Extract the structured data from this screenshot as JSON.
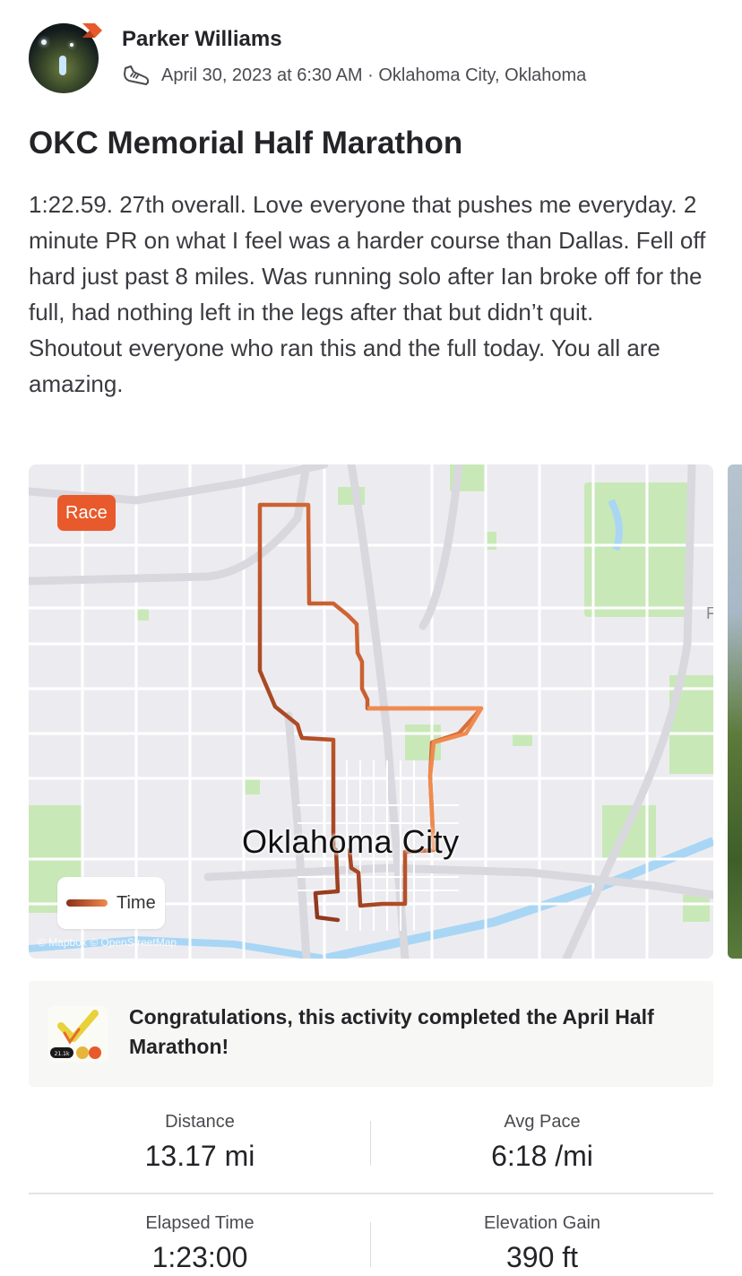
{
  "user": {
    "name": "Parker Williams",
    "avatar_icon": "profile-photo",
    "badge_icon": "subscriber-badge-icon"
  },
  "activity": {
    "type_icon": "shoe-icon",
    "meta": "April 30, 2023 at 6:30 AM · Oklahoma City, Oklahoma",
    "title": "OKC Memorial Half Marathon",
    "description": [
      "1:22.59. 27th overall. Love everyone that pushes me everyday. 2 minute PR on what I feel was a harder course than Dallas. Fell off hard just past 8 miles. Was running solo after Ian broke off for the full, had nothing left in the legs after that but didn’t quit.",
      "Shoutout everyone who ran this and the full today. You all are amazing."
    ]
  },
  "map": {
    "badge": "Race",
    "badge_color": "#e85a2b",
    "city_label": "Oklahoma City",
    "legend_label": "Time",
    "attribution": "© Mapbox © OpenStreetMap",
    "route_colors": {
      "start": "#8a2e1a",
      "mid": "#c45a2c",
      "end": "#f08a4e"
    }
  },
  "challenge": {
    "icon": "challenge-trophy-icon",
    "text": "Congratulations, this activity completed the April Half Marathon!"
  },
  "stats": [
    {
      "label": "Distance",
      "value": "13.17 mi"
    },
    {
      "label": "Avg Pace",
      "value": "6:18 /mi"
    },
    {
      "label": "Elapsed Time",
      "value": "1:23:00"
    },
    {
      "label": "Elevation Gain",
      "value": "390 ft"
    }
  ]
}
